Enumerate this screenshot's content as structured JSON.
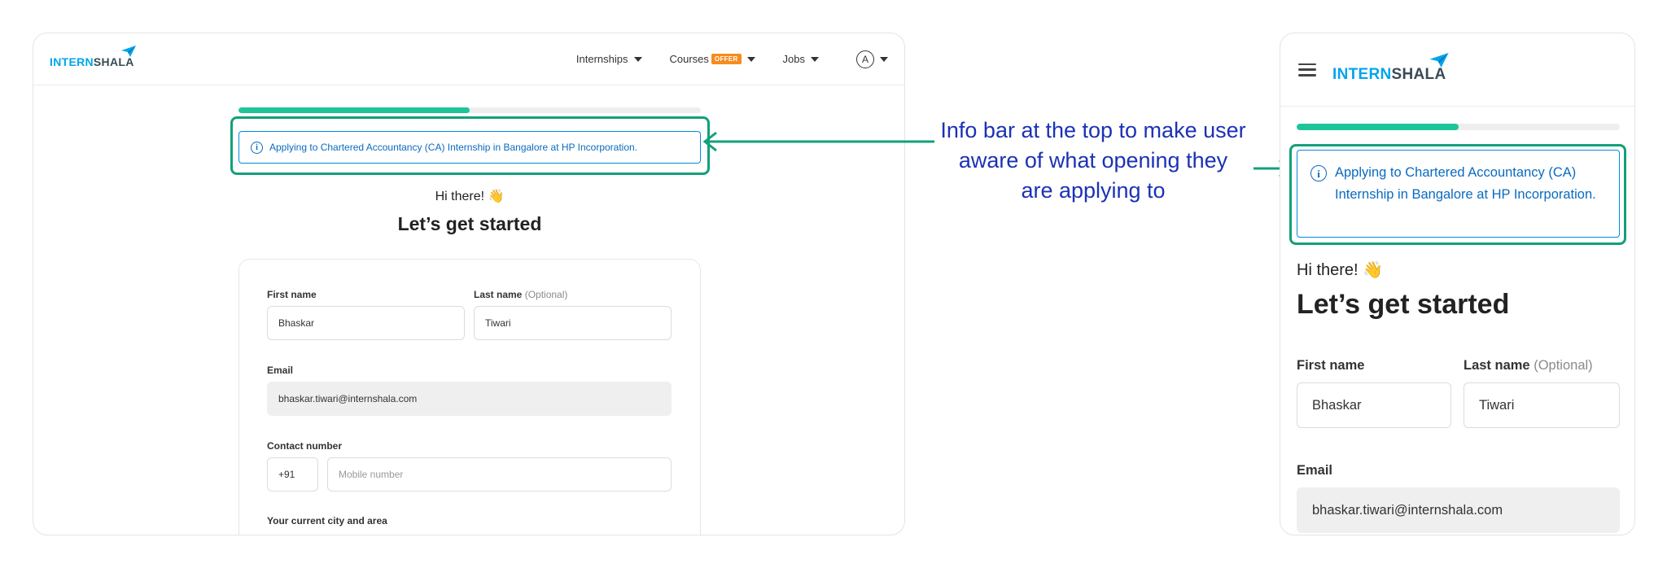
{
  "brand": {
    "part1": "INTERN",
    "part2": "SHALA"
  },
  "nav": {
    "internships": "Internships",
    "courses": "Courses",
    "offer_badge": "OFFER",
    "jobs": "Jobs",
    "avatar_letter": "A"
  },
  "progress": {
    "fraction": 0.5
  },
  "info_bar": {
    "text": "Applying to Chartered Accountancy (CA) Internship in Bangalore at HP Incorporation."
  },
  "greeting": "Hi there! 👋",
  "title": "Let’s get started",
  "form": {
    "first_name_label": "First name",
    "first_name_value": "Bhaskar",
    "last_name_label": "Last name",
    "last_name_optional": "(Optional)",
    "last_name_value": "Tiwari",
    "email_label": "Email",
    "email_value": "bhaskar.tiwari@internshala.com",
    "contact_label": "Contact number",
    "country_code": "+91",
    "mobile_placeholder": "Mobile number",
    "city_label": "Your current city and area"
  },
  "annotation": {
    "line1": "Info bar at the top to make user",
    "line2": "aware of what opening they",
    "line3": "are applying to"
  },
  "colors": {
    "brand_blue": "#00a5ec",
    "brand_dark": "#3a4a55",
    "progress": "#1fc59a",
    "highlight": "#13a07a",
    "annotation": "#1b32b5",
    "info_text": "#0a6ac0",
    "offer": "#f68b1e"
  },
  "icons": [
    "paper-plane-icon",
    "caret-down-icon",
    "info-circle-icon",
    "hamburger-menu-icon",
    "arrow-left-icon",
    "arrow-right-icon",
    "avatar-icon"
  ]
}
